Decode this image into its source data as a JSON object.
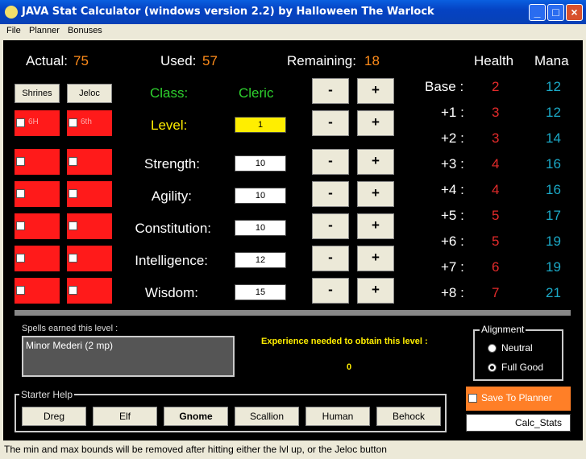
{
  "window": {
    "title": "JAVA Stat Calculator (windows version 2.2) by Halloween The Warlock"
  },
  "menu": {
    "items": [
      "File",
      "Planner",
      "Bonuses"
    ]
  },
  "points": {
    "actual_label": "Actual:",
    "actual_value": "75",
    "used_label": "Used:",
    "used_value": "57",
    "remaining_label": "Remaining:",
    "remaining_value": "18"
  },
  "buttons": {
    "shrines": "Shrines",
    "jeloc": "Jeloc",
    "minus": "-",
    "plus": "+"
  },
  "shrine_boxes": {
    "label_6h": "6H",
    "label_6th": "6th"
  },
  "class": {
    "label": "Class:",
    "value": "Cleric"
  },
  "level": {
    "label": "Level:",
    "value": "1"
  },
  "stats": [
    {
      "label": "Strength:",
      "value": "10"
    },
    {
      "label": "Agility:",
      "value": "10"
    },
    {
      "label": "Constitution:",
      "value": "10"
    },
    {
      "label": "Intelligence:",
      "value": "12"
    },
    {
      "label": "Wisdom:",
      "value": "15"
    }
  ],
  "table": {
    "health_header": "Health",
    "mana_header": "Mana",
    "rows": [
      {
        "label": "Base :",
        "health": "2",
        "mana": "12"
      },
      {
        "label": "+1 :",
        "health": "3",
        "mana": "12"
      },
      {
        "label": "+2 :",
        "health": "3",
        "mana": "14"
      },
      {
        "label": "+3 :",
        "health": "4",
        "mana": "16"
      },
      {
        "label": "+4 :",
        "health": "4",
        "mana": "16"
      },
      {
        "label": "+5 :",
        "health": "5",
        "mana": "17"
      },
      {
        "label": "+6 :",
        "health": "5",
        "mana": "19"
      },
      {
        "label": "+7 :",
        "health": "6",
        "mana": "19"
      },
      {
        "label": "+8 :",
        "health": "7",
        "mana": "21"
      }
    ]
  },
  "spells": {
    "label": "Spells earned this level :",
    "value": "Minor Mederi (2 mp)"
  },
  "experience": {
    "label": "Experience needed to obtain this level :",
    "value": "0"
  },
  "alignment": {
    "label": "Alignment",
    "options": [
      "Neutral",
      "Full Good"
    ],
    "selected": "Full Good"
  },
  "starter": {
    "label": "Starter Help",
    "buttons": [
      "Dreg",
      "Elf",
      "Gnome",
      "Scallion",
      "Human",
      "Behock"
    ],
    "active": "Gnome"
  },
  "planner": {
    "save_label": "Save To Planner",
    "filename": "Calc_Stats"
  },
  "status": {
    "text": "The min and max bounds will be removed after hitting either the lvl up, or the Jeloc button"
  },
  "colors": {
    "accent_orange": "#ff8c1a",
    "class_green": "#2ed12e",
    "level_yellow": "#ffee00",
    "health_red": "#e32b2b",
    "mana_cyan": "#1ba9c7",
    "panel_bg": "#000000"
  }
}
